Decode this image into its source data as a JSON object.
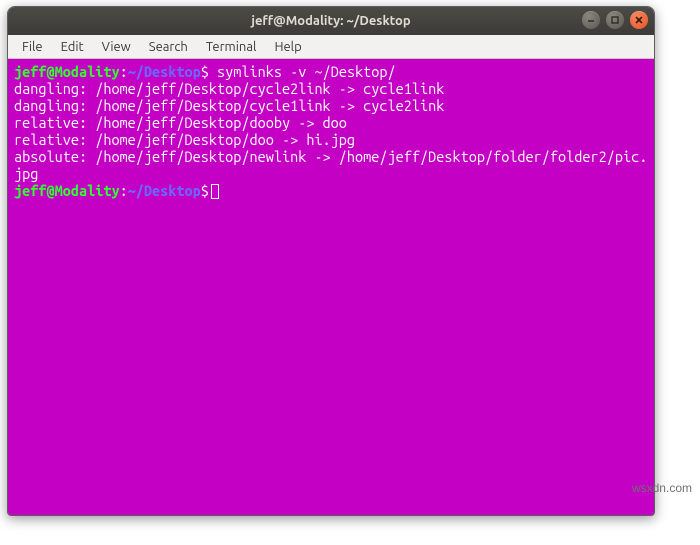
{
  "window": {
    "title": "jeff@Modality: ~/Desktop"
  },
  "menubar": {
    "items": [
      "File",
      "Edit",
      "View",
      "Search",
      "Terminal",
      "Help"
    ]
  },
  "prompt": {
    "user_host": "jeff@Modality",
    "colon": ":",
    "path": "~/Desktop",
    "dollar": "$"
  },
  "terminal": {
    "command1": " symlinks -v ~/Desktop/",
    "output_lines": [
      "dangling: /home/jeff/Desktop/cycle2link -> cycle1link",
      "dangling: /home/jeff/Desktop/cycle1link -> cycle2link",
      "relative: /home/jeff/Desktop/dooby -> doo",
      "relative: /home/jeff/Desktop/doo -> hi.jpg",
      "absolute: /home/jeff/Desktop/newlink -> /home/jeff/Desktop/folder/folder2/pic.jpg"
    ]
  },
  "watermark": "wsxdn.com"
}
